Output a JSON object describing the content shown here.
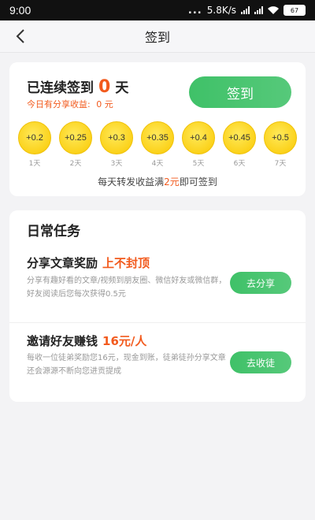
{
  "status_bar": {
    "time": "9:00",
    "dots": "...",
    "net_speed": "5.8K/s",
    "battery": "67"
  },
  "nav": {
    "title": "签到"
  },
  "checkin": {
    "signed_prefix": "已连续签到",
    "signed_count": "0",
    "signed_suffix": "天",
    "today_label": "今日有分享收益:",
    "today_value": "0 元",
    "button_label": "签到",
    "days": [
      {
        "amount": "+0.2",
        "label": "1天"
      },
      {
        "amount": "+0.25",
        "label": "2天"
      },
      {
        "amount": "+0.3",
        "label": "3天"
      },
      {
        "amount": "+0.35",
        "label": "4天"
      },
      {
        "amount": "+0.4",
        "label": "5天"
      },
      {
        "amount": "+0.45",
        "label": "6天"
      },
      {
        "amount": "+0.5",
        "label": "7天"
      }
    ],
    "rule_prefix": "每天转发收益满",
    "rule_amount": "2元",
    "rule_suffix": "即可签到"
  },
  "tasks": {
    "title": "日常任务",
    "items": [
      {
        "title": "分享文章奖励",
        "reward": "上不封顶",
        "desc": "分享有趣好看的文章/视频到朋友圈、微信好友或微信群，好友阅读后您每次获得0.5元",
        "button": "去分享"
      },
      {
        "title": "邀请好友赚钱",
        "reward": "16元/人",
        "desc": "每收一位徒弟奖励您16元，现金到账，徒弟徒孙分享文章还会源源不断向您进贡提成",
        "button": "去收徒"
      }
    ]
  },
  "colors": {
    "accent_green": "#3fc168",
    "accent_orange": "#f25a1d",
    "coin_yellow": "#fbd21b"
  }
}
